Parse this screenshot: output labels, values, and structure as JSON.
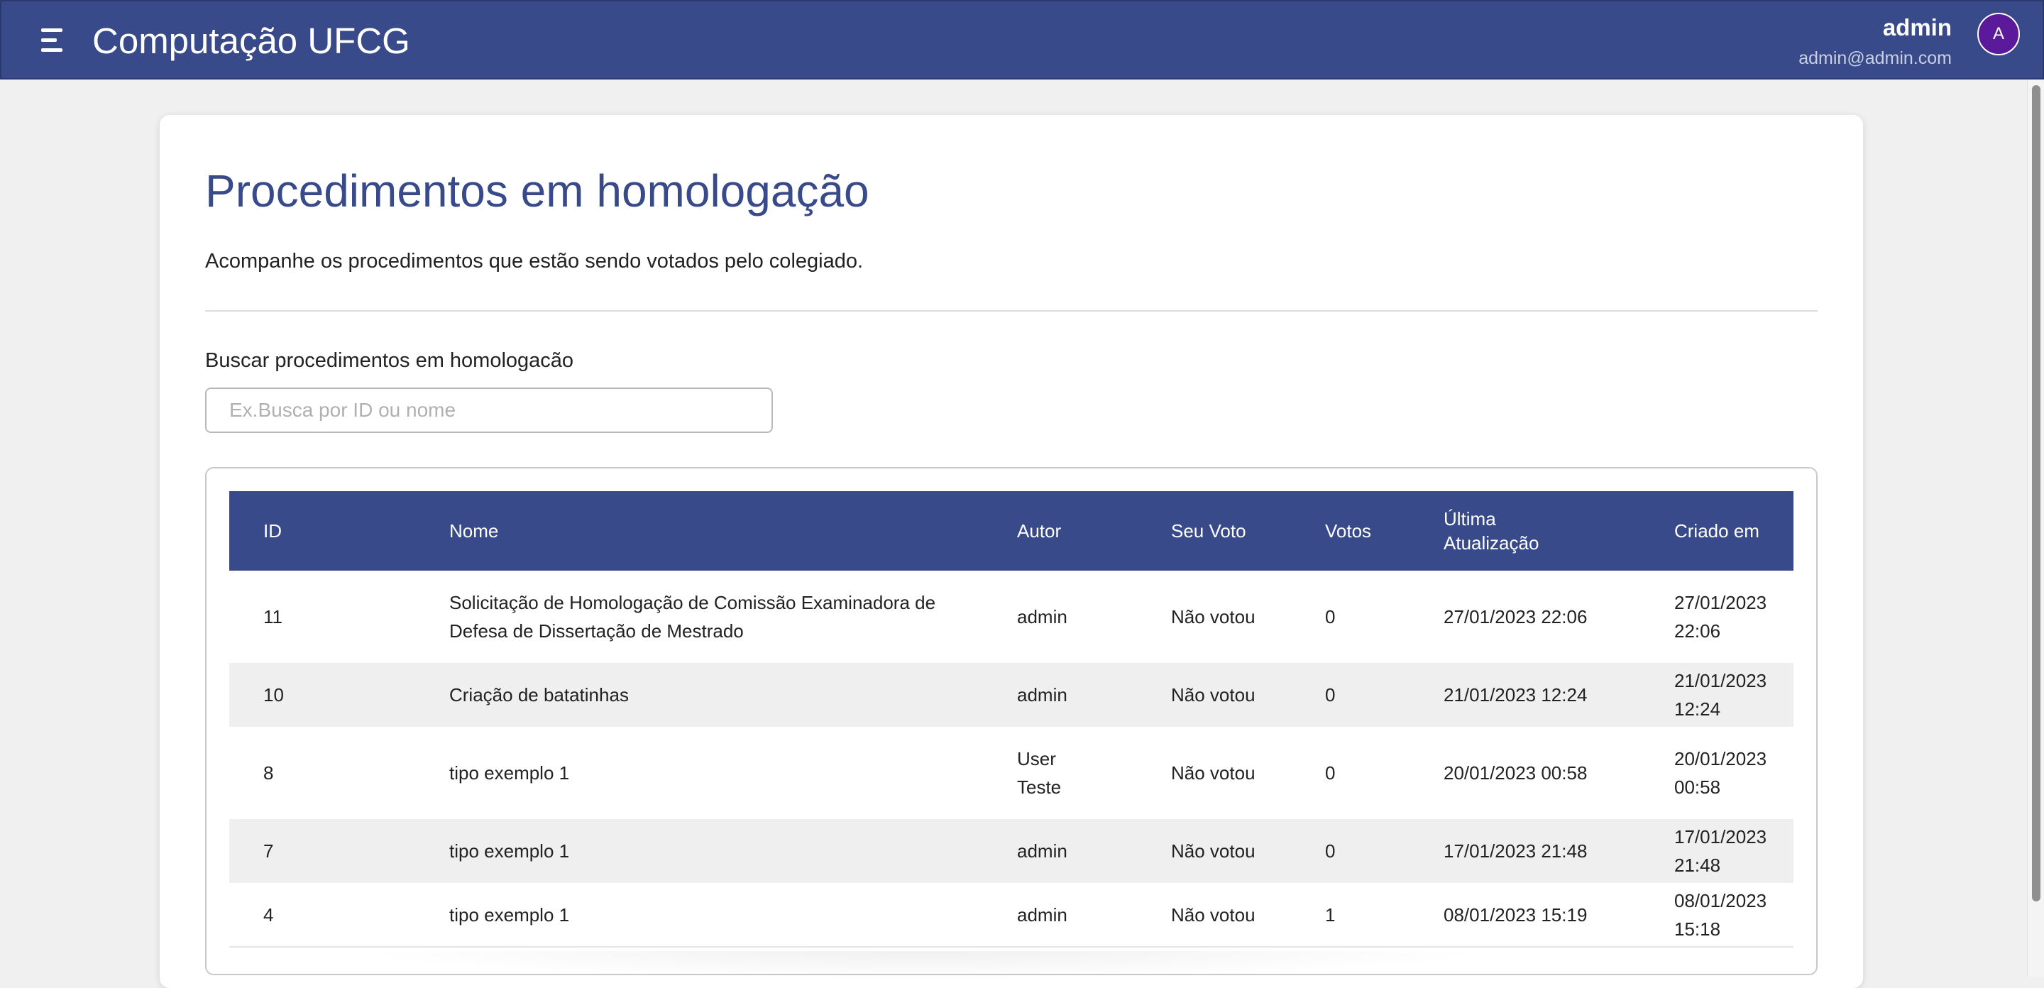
{
  "header": {
    "app_title": "Computação UFCG",
    "user_name": "admin",
    "user_email": "admin@admin.com",
    "avatar_initial": "A"
  },
  "page": {
    "title": "Procedimentos em homologação",
    "description": "Acompanhe os procedimentos que estão sendo votados pelo colegiado.",
    "search_label": "Buscar procedimentos em homologacão",
    "search_placeholder": "Ex.Busca por ID ou nome",
    "search_value": ""
  },
  "table": {
    "columns": [
      "ID",
      "Nome",
      "Autor",
      "Seu Voto",
      "Votos",
      "Última Atualização",
      "Criado em"
    ],
    "rows": [
      {
        "id": "11",
        "nome": "Solicitação de Homologação de Comissão Examinadora de Defesa de Dissertação de Mestrado",
        "autor": "admin",
        "voto": "Não votou",
        "votos": "0",
        "atualizacao": "27/01/2023 22:06",
        "criado": "27/01/2023 22:06"
      },
      {
        "id": "10",
        "nome": "Criação de batatinhas",
        "autor": "admin",
        "voto": "Não votou",
        "votos": "0",
        "atualizacao": "21/01/2023 12:24",
        "criado": "21/01/2023 12:24"
      },
      {
        "id": "8",
        "nome": "tipo exemplo 1",
        "autor": "User Teste",
        "voto": "Não votou",
        "votos": "0",
        "atualizacao": "20/01/2023 00:58",
        "criado": "20/01/2023 00:58"
      },
      {
        "id": "7",
        "nome": "tipo exemplo 1",
        "autor": "admin",
        "voto": "Não votou",
        "votos": "0",
        "atualizacao": "17/01/2023 21:48",
        "criado": "17/01/2023 21:48"
      },
      {
        "id": "4",
        "nome": "tipo exemplo 1",
        "autor": "admin",
        "voto": "Não votou",
        "votos": "1",
        "atualizacao": "08/01/2023 15:19",
        "criado": "08/01/2023 15:18"
      }
    ]
  },
  "colors": {
    "brand": "#384a8a",
    "avatar": "#5a1a99",
    "row_alt": "#efefef"
  },
  "icons": {
    "menu": "menu-icon"
  }
}
